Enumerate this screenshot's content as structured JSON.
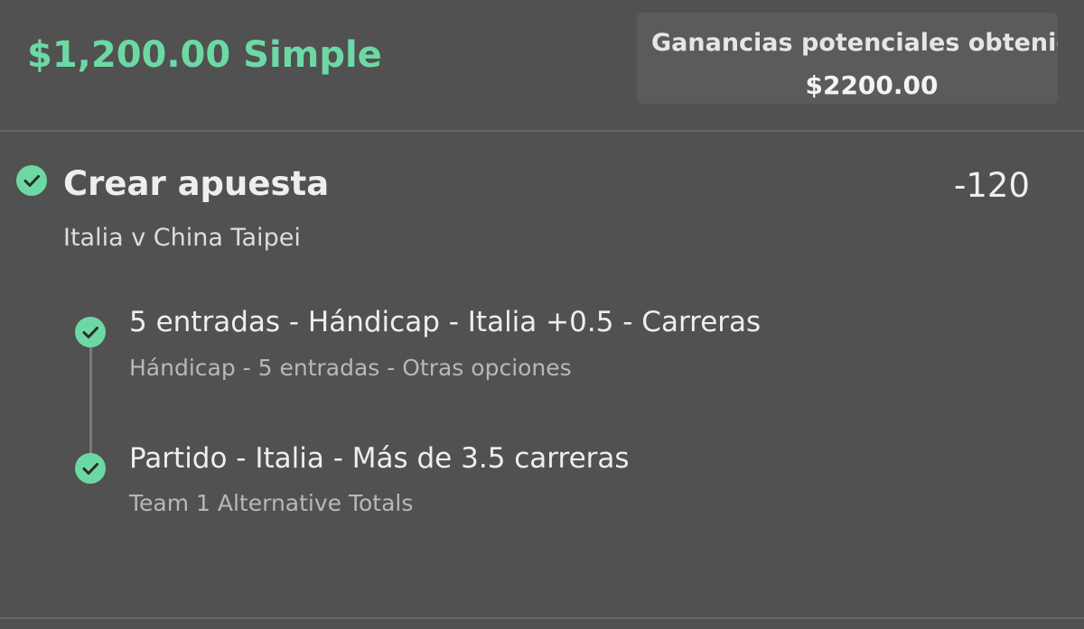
{
  "header": {
    "stake_text": "$1,200.00 Simple",
    "winnings_label": "Ganancias potenciales obtenidas",
    "winnings_value": "$2200.00"
  },
  "bet": {
    "title": "Crear apuesta",
    "odds": "-120",
    "match": "Italia v China Taipei",
    "selections": [
      {
        "title": "5 entradas - Hándicap - Italia +0.5 - Carreras",
        "subtitle": "Hándicap - 5 entradas - Otras opciones"
      },
      {
        "title": "Partido - Italia - Más de 3.5 carreras",
        "subtitle": "Team 1 Alternative Totals"
      }
    ]
  },
  "colors": {
    "accent": "#6cd9a4",
    "background": "#515151",
    "box_background": "#5b5b5b"
  }
}
